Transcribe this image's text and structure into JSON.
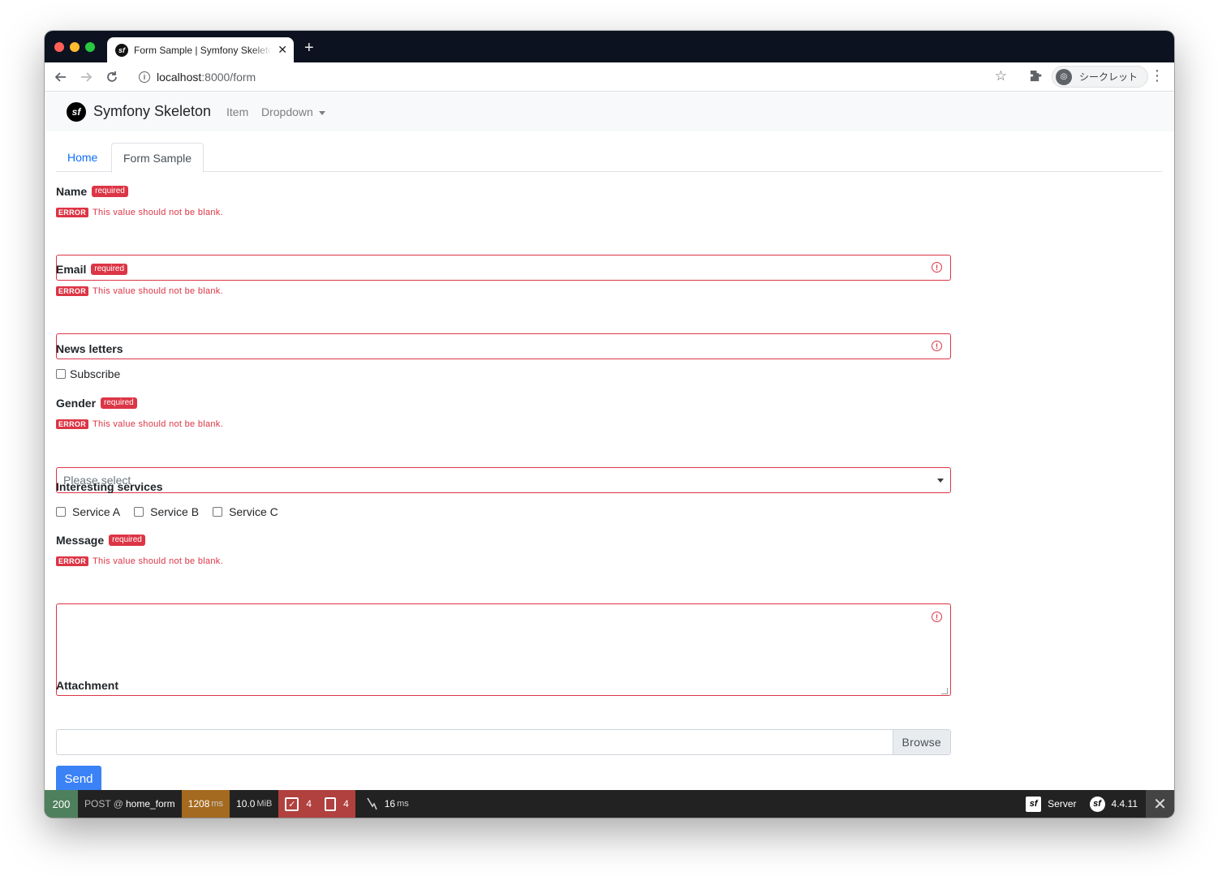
{
  "browser": {
    "tab_title": "Form Sample | Symfony Skeleton",
    "tab_close": "✕",
    "new_tab": "+",
    "url_host": "localhost",
    "url_rest": ":8000/form",
    "incognito_label": "シークレット"
  },
  "navbar": {
    "brand": "Symfony Skeleton",
    "item": "Item",
    "dropdown": "Dropdown"
  },
  "tabs": {
    "home": "Home",
    "active": "Form Sample"
  },
  "form": {
    "required_badge": "required",
    "error_badge": "ERROR",
    "name": {
      "label": "Name",
      "error": "This value should not be blank."
    },
    "email": {
      "label": "Email",
      "error": "This value should not be blank."
    },
    "newsletters": {
      "label": "News letters",
      "option": "Subscribe"
    },
    "gender": {
      "label": "Gender",
      "error": "This value should not be blank.",
      "placeholder": "Please select"
    },
    "services": {
      "label": "Interesting services",
      "options": [
        "Service A",
        "Service B",
        "Service C"
      ]
    },
    "message": {
      "label": "Message",
      "error": "This value should not be blank."
    },
    "attachment": {
      "label": "Attachment",
      "browse": "Browse"
    },
    "send": "Send"
  },
  "debug_toolbar": {
    "status": "200",
    "method": "POST @",
    "route": "home_form",
    "time": "1208",
    "time_unit": "ms",
    "memory": "10.0",
    "memory_unit": "MiB",
    "forms_count": "4",
    "logs_count": "4",
    "db_time": "16",
    "db_unit": "ms",
    "server": "Server",
    "version": "4.4.11"
  },
  "colors": {
    "primary": "#3b82f6",
    "danger": "#dc3545",
    "status_ok": "#4f805d",
    "time_warning": "#a46a1f"
  }
}
